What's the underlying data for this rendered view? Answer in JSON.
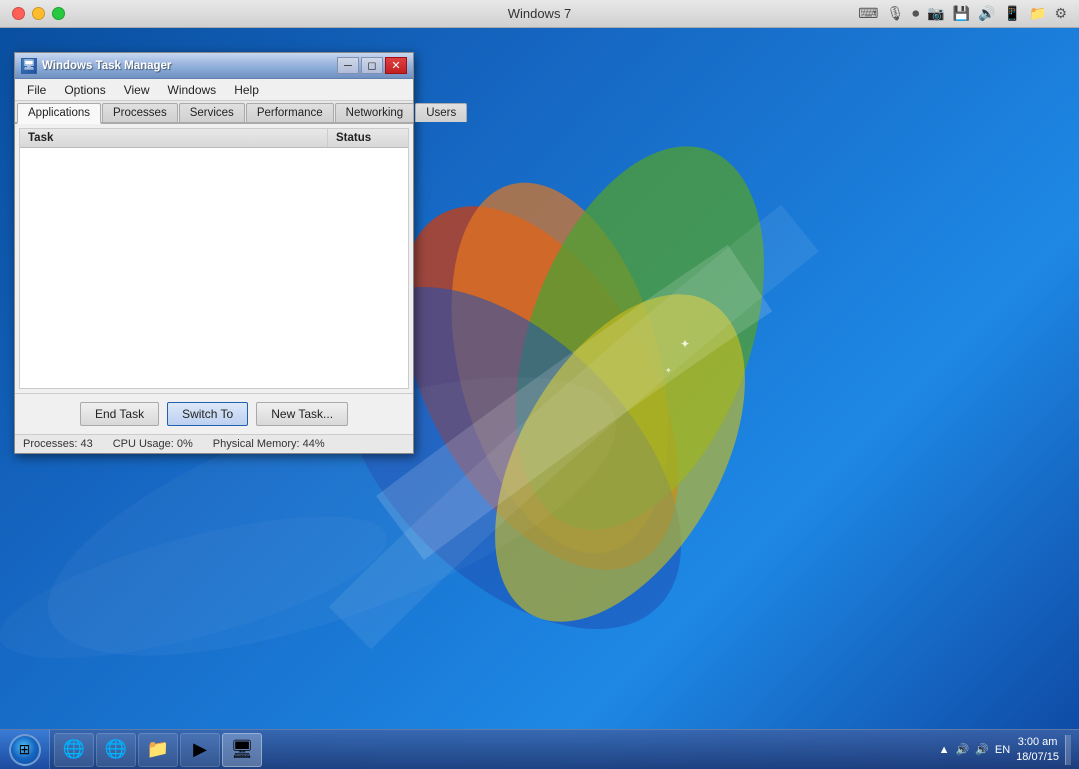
{
  "mac": {
    "title": "Windows 7",
    "close": "●",
    "minimize": "●",
    "maximize": "●"
  },
  "taskmanager": {
    "title": "Windows Task Manager",
    "menus": [
      "File",
      "Options",
      "View",
      "Windows",
      "Help"
    ],
    "tabs": [
      "Applications",
      "Processes",
      "Services",
      "Performance",
      "Networking",
      "Users"
    ],
    "active_tab": "Applications",
    "table": {
      "col_task": "Task",
      "col_status": "Status"
    },
    "buttons": {
      "end_task": "End Task",
      "switch_to": "Switch To",
      "new_task": "New Task..."
    },
    "statusbar": {
      "processes": "Processes: 43",
      "cpu": "CPU Usage: 0%",
      "memory": "Physical Memory: 44%"
    }
  },
  "taskbar": {
    "lang": "EN",
    "time": "3:00 am",
    "date": "18/07/15",
    "items": [
      "🌐",
      "🌐",
      "📁",
      "▶",
      "🖥"
    ]
  }
}
